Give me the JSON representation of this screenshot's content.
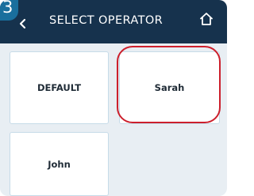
{
  "step_number": "3",
  "header": {
    "title": "SELECT OPERATOR",
    "back_icon": "back-arrow-icon",
    "home_icon": "home-icon"
  },
  "operators": [
    {
      "label": "DEFAULT",
      "selected": false
    },
    {
      "label": "Sarah",
      "selected": true
    },
    {
      "label": "John",
      "selected": false
    }
  ],
  "colors": {
    "header_bg": "#16324d",
    "step_tab": "#1a6f9d",
    "background": "#e8eef3",
    "tile_border": "#c6dbe8",
    "highlight": "#cc1f2c"
  }
}
